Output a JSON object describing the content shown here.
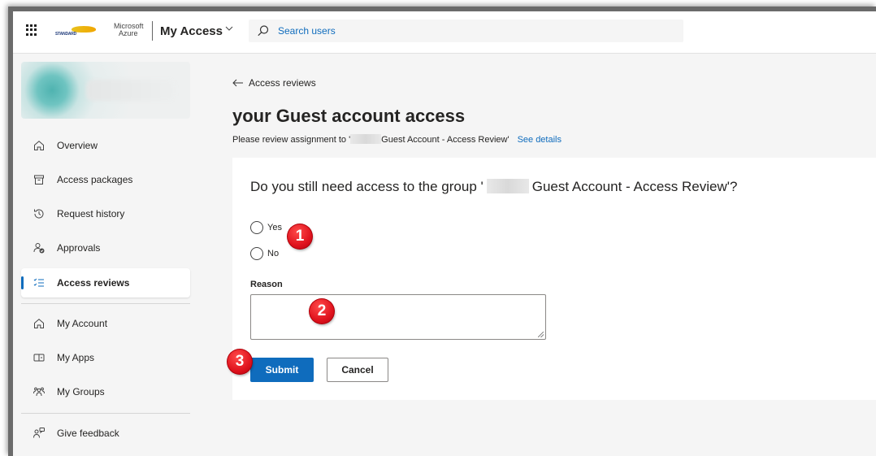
{
  "topbar": {
    "org_logo_text": "STANDARD",
    "ms_line1": "Microsoft",
    "ms_line2": "Azure",
    "app_name": "My Access",
    "search_placeholder": "Search users"
  },
  "sidebar": {
    "items": [
      {
        "label": "Overview",
        "icon": "home-icon"
      },
      {
        "label": "Access packages",
        "icon": "package-icon"
      },
      {
        "label": "Request history",
        "icon": "history-icon"
      },
      {
        "label": "Approvals",
        "icon": "approvals-icon"
      },
      {
        "label": "Access reviews",
        "icon": "checklist-icon",
        "active": true
      },
      {
        "label": "My Account",
        "icon": "home-icon"
      },
      {
        "label": "My Apps",
        "icon": "apps-icon"
      },
      {
        "label": "My Groups",
        "icon": "groups-icon"
      },
      {
        "label": "Give feedback",
        "icon": "feedback-icon"
      }
    ]
  },
  "main": {
    "back_label": "Access reviews",
    "title": "your Guest account access",
    "review_prefix": "Please review assignment to '",
    "review_suffix": "Guest Account - Access Review'",
    "see_details": "See details",
    "question_prefix": "Do you still need access to the group '",
    "question_suffix": "Guest Account - Access Review'?",
    "option_yes": "Yes",
    "option_no": "No",
    "reason_label": "Reason",
    "submit_label": "Submit",
    "cancel_label": "Cancel"
  },
  "annotations": [
    "1",
    "2",
    "3"
  ],
  "colors": {
    "accent": "#0f6cbd",
    "badge": "#e0141e"
  }
}
